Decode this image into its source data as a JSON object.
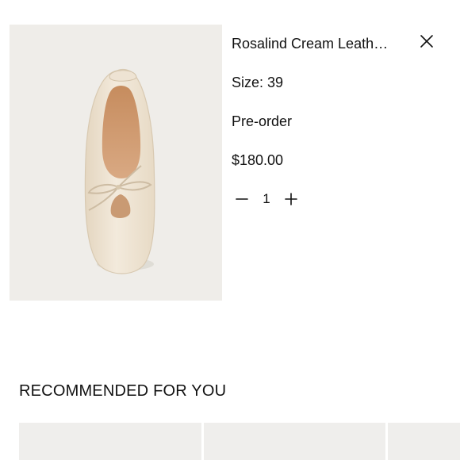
{
  "product": {
    "image_alt": "Cream leather ballet flat with bow",
    "title": "Rosalind Cream Leath…",
    "size": "Size: 39",
    "status": "Pre-order",
    "price": "$180.00",
    "quantity": "1"
  },
  "icons": {
    "close": "close-icon",
    "decrease": "minus-icon",
    "increase": "plus-icon"
  },
  "recommendations": {
    "heading": "RECOMMENDED FOR YOU"
  },
  "colors": {
    "image_background": "#efede9",
    "card_background": "#efeeec",
    "text": "#111111"
  }
}
